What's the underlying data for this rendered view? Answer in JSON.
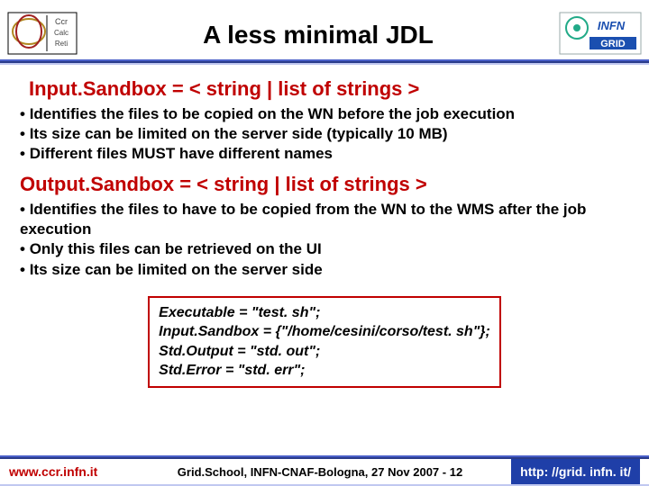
{
  "header": {
    "title": "A less minimal JDL"
  },
  "section1": {
    "title": "Input.Sandbox = < string | list of strings >",
    "bullets": [
      "Identifies the files to be copied on the WN before the job execution",
      "Its size can be limited on the server side (typically 10 MB)",
      "Different files MUST have different names"
    ]
  },
  "section2": {
    "title": "Output.Sandbox = < string | list of strings >",
    "bullets": [
      "Identifies the files to have to be copied from the WN to the WMS after the job execution",
      "Only this files can be retrieved on the UI",
      "Its size can be limited on the server side"
    ]
  },
  "code": {
    "line1": "Executable = \"test. sh\";",
    "line2": "Input.Sandbox = {\"/home/cesini/corso/test. sh\"};",
    "line3": "Std.Output = \"std. out\";",
    "line4": "Std.Error = \"std. err\";"
  },
  "footer": {
    "left": "www.ccr.infn.it",
    "center": "Grid.School, INFN-CNAF-Bologna, 27 Nov 2007  -  12",
    "right": "http: //grid. infn. it/"
  }
}
